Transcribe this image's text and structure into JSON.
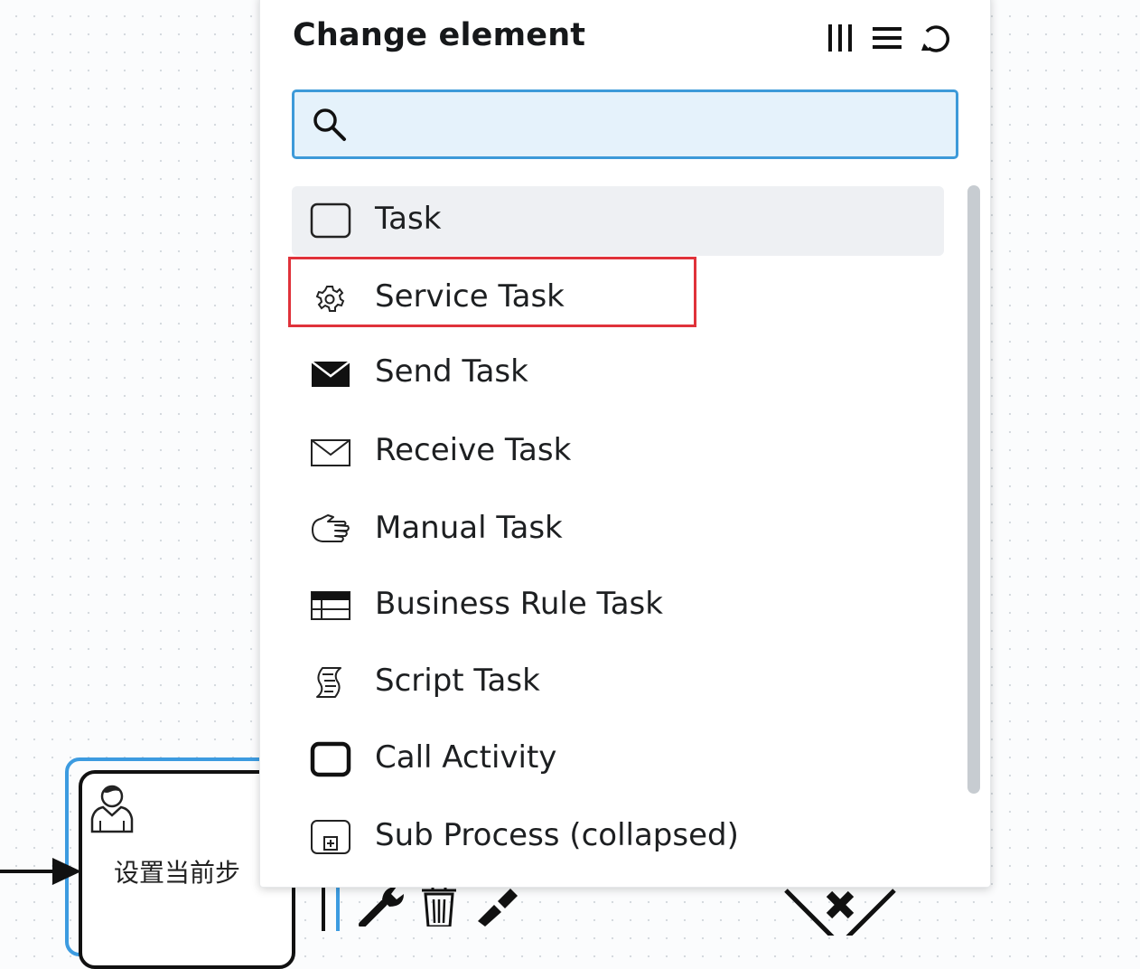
{
  "popup": {
    "title": "Change element",
    "header_icons": [
      "columns-icon",
      "list-icon",
      "reset-icon"
    ],
    "search": {
      "placeholder": "",
      "value": ""
    },
    "entries": [
      {
        "label": "Task",
        "icon": "task-icon",
        "active": true
      },
      {
        "label": "Service Task",
        "icon": "gear-icon",
        "highlighted": true
      },
      {
        "label": "Send Task",
        "icon": "envelope-filled-icon"
      },
      {
        "label": "Receive Task",
        "icon": "envelope-outline-icon"
      },
      {
        "label": "Manual Task",
        "icon": "hand-icon"
      },
      {
        "label": "Business Rule Task",
        "icon": "table-icon"
      },
      {
        "label": "Script Task",
        "icon": "script-icon"
      },
      {
        "label": "Call Activity",
        "icon": "call-activity-icon"
      },
      {
        "label": "Sub Process (collapsed)",
        "icon": "subprocess-icon"
      }
    ],
    "highlight_color": "#e0323a",
    "search_border_color": "#3d9ad9"
  },
  "canvas": {
    "task_label": "设置当前步",
    "selection_color": "#3c9be0"
  }
}
